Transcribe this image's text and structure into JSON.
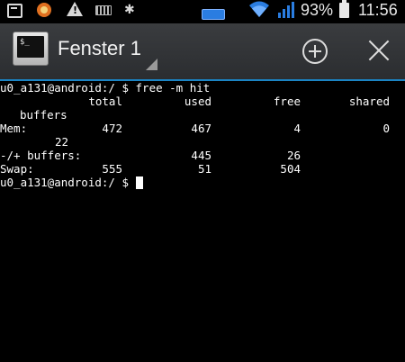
{
  "status_bar": {
    "battery_percent": "93%",
    "time": "11:56",
    "icons": [
      "gallery-icon",
      "app-notification-icon",
      "warning-icon",
      "keyboard-icon",
      "android-debug-icon",
      "battery-small-icon",
      "wifi-icon",
      "signal-icon",
      "battery-icon"
    ]
  },
  "action_bar": {
    "title": "Fenster 1",
    "add_icon": "add-circle-icon",
    "close_icon": "close-icon",
    "app_icon": "terminal-icon",
    "app_icon_text": "$_",
    "accent_color": "#1b84c4"
  },
  "terminal": {
    "prompt_command": "u0_a131@android:/ $ free -m hit",
    "header": {
      "total": "total",
      "used": "used",
      "free": "free",
      "shared": "shared",
      "buffers": "buffers"
    },
    "mem": {
      "label": "Mem:",
      "total": "472",
      "used": "467",
      "free": "4",
      "shared": "0",
      "buffers": "22"
    },
    "buffers_row": {
      "label": "-/+ buffers:",
      "used": "445",
      "free": "26"
    },
    "swap": {
      "label": "Swap:",
      "total": "555",
      "used": "51",
      "free": "504"
    },
    "prompt": "u0_a131@android:/ $ "
  }
}
